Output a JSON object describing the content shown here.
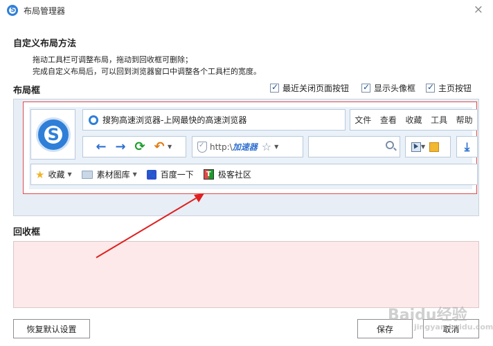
{
  "window": {
    "title": "布局管理器"
  },
  "custom": {
    "heading": "自定义布局方法",
    "line1": "拖动工具栏可调整布局，拖动到回收框可删除；",
    "line2": "完成自定义布局后，可以回到浏览器窗口中调整各个工具栏的宽度。"
  },
  "layout": {
    "heading": "布局框",
    "checkboxes": [
      {
        "label": "最近关闭页面按钮",
        "checked": true
      },
      {
        "label": "显示头像框",
        "checked": true
      },
      {
        "label": "主页按钮",
        "checked": true
      }
    ]
  },
  "preview": {
    "title_text": "搜狗高速浏览器-上网最快的高速浏览器",
    "menu": [
      "文件",
      "查看",
      "收藏",
      "工具",
      "帮助"
    ],
    "address_prefix": "http:\\",
    "address_accel": "加速器",
    "favorites": [
      {
        "label": "收藏"
      },
      {
        "label": "素材图库"
      },
      {
        "label": "百度一下"
      },
      {
        "label": "极客社区"
      }
    ]
  },
  "recycle": {
    "heading": "回收框"
  },
  "buttons": {
    "restore": "恢复默认设置",
    "save": "保存",
    "cancel": "取消"
  },
  "watermark": {
    "text": "Baidu经验",
    "sub": "jingyan.baidu.com"
  },
  "colors": {
    "accent": "#2d6fd0",
    "highlight_border": "#e04a4a",
    "recycle_bg": "#fde9e9"
  }
}
